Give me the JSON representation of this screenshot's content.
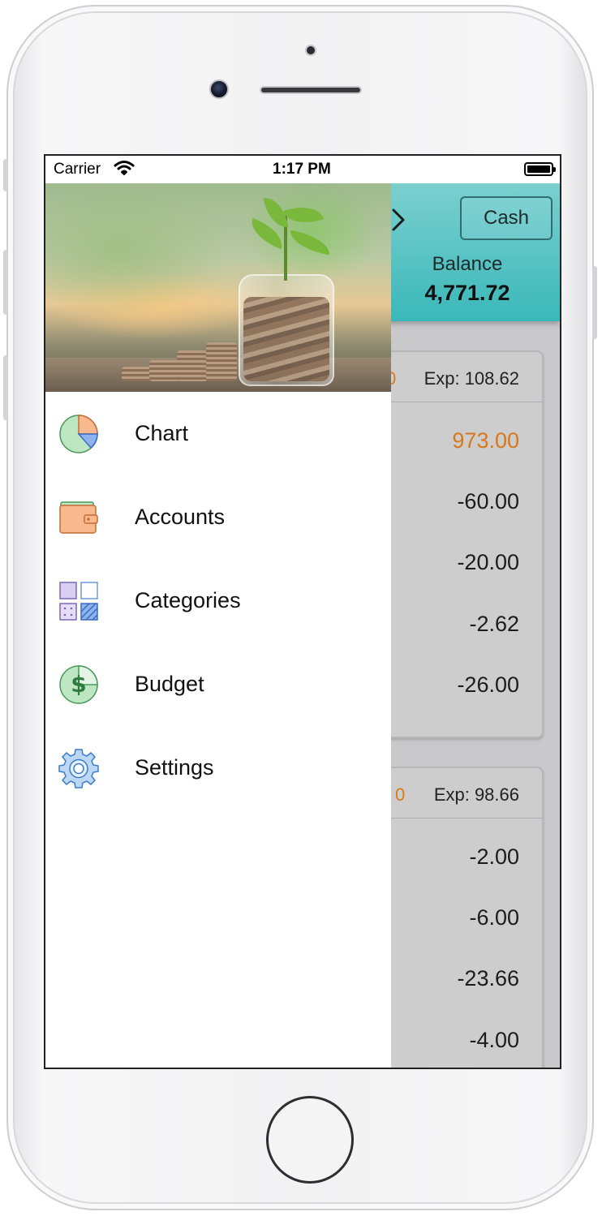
{
  "status_bar": {
    "carrier": "Carrier",
    "time": "1:17 PM"
  },
  "header": {
    "cash_button": "Cash",
    "balance_label": "Balance",
    "balance_value": "4,771.72"
  },
  "day_cards": [
    {
      "income_tail": "0",
      "expense": "Exp: 108.62",
      "transactions": [
        "973.00",
        "-60.00",
        "-20.00",
        "-2.62",
        "-26.00"
      ]
    },
    {
      "income_tail": "0",
      "expense": "Exp: 98.66",
      "transactions": [
        "-2.00",
        "-6.00",
        "-23.66",
        "-4.00"
      ]
    }
  ],
  "drawer": {
    "menu": [
      {
        "label": "Chart",
        "icon": "pie-chart-icon"
      },
      {
        "label": "Accounts",
        "icon": "wallet-icon"
      },
      {
        "label": "Categories",
        "icon": "categories-grid-icon"
      },
      {
        "label": "Budget",
        "icon": "dollar-budget-icon"
      },
      {
        "label": "Settings",
        "icon": "gear-icon"
      }
    ]
  },
  "colors": {
    "header_teal": "#3ab8b9",
    "income_orange": "#d9781a",
    "drawer_bg": "#ffffff",
    "content_gray": "#c9c9cb"
  }
}
